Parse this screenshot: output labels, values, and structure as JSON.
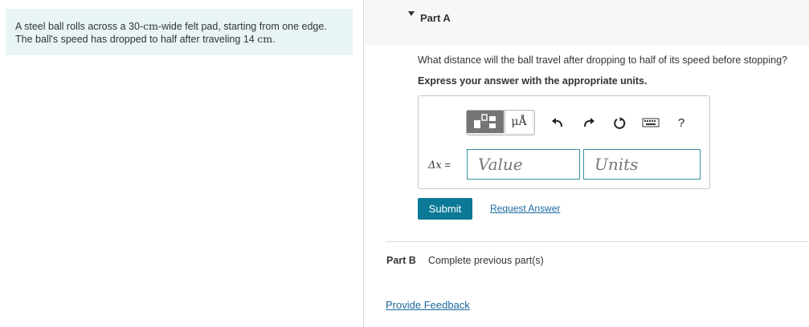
{
  "problem": {
    "text_part1": "A steel ball rolls across a 30-",
    "unit_cm1": "cm",
    "text_part2": "-wide felt pad, starting from one edge.",
    "text_line2": "The ball's speed has dropped to half after traveling 14 ",
    "unit_cm2": "cm",
    "text_line2_end": "."
  },
  "part_a": {
    "title": "Part A",
    "question": "What distance will the ball travel after dropping to half of its speed before stopping?",
    "instruction": "Express your answer with the appropriate units.",
    "toolbar": {
      "units_label": "μÅ",
      "help_label": "?"
    },
    "eq_var": "Δx",
    "eq_sign": " =",
    "value_placeholder": "Value",
    "units_placeholder": "Units",
    "submit_label": "Submit",
    "request_label": "Request Answer"
  },
  "part_b": {
    "title": "Part B",
    "status": "Complete previous part(s)"
  },
  "feedback_label": "Provide Feedback",
  "colors": {
    "problem_bg": "#e9f4f6",
    "submit_bg": "#0c7997",
    "link": "#1a6a9e",
    "input_border": "#3a8fa6"
  },
  "icons": [
    "templates-icon",
    "undo-icon",
    "redo-icon",
    "reset-icon",
    "keyboard-icon",
    "help-icon"
  ]
}
